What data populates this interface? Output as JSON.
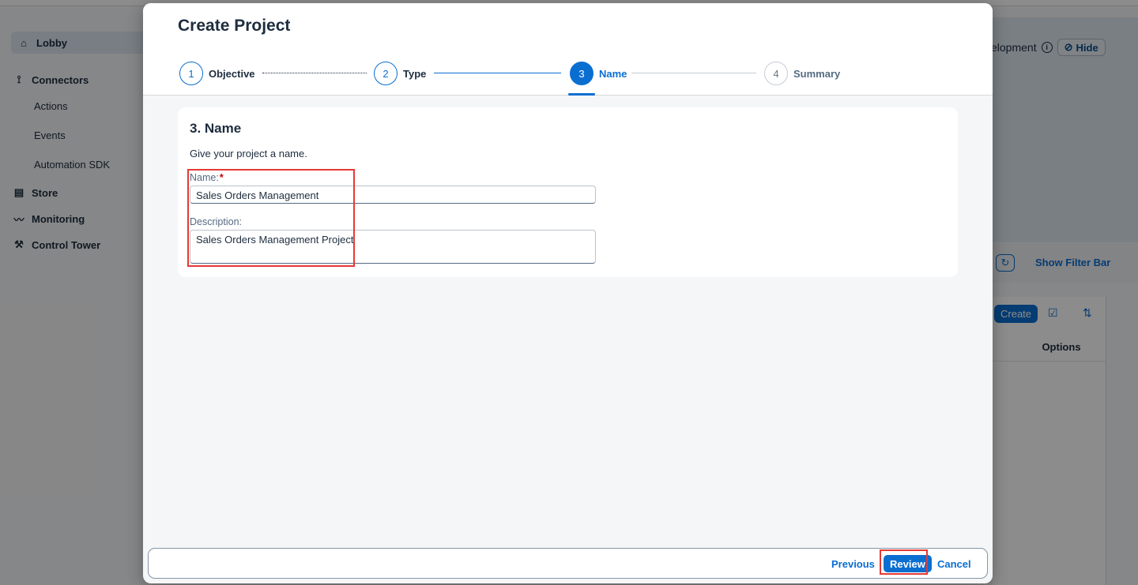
{
  "background": {
    "sidebar": {
      "items": [
        {
          "label": "Lobby",
          "icon": "home-icon"
        },
        {
          "label": "Connectors",
          "icon": "connector-icon"
        },
        {
          "label": "Actions"
        },
        {
          "label": "Events"
        },
        {
          "label": "Automation SDK"
        },
        {
          "label": "Store",
          "icon": "store-icon"
        },
        {
          "label": "Monitoring",
          "icon": "chart-line-icon"
        },
        {
          "label": "Control Tower",
          "icon": "wrench-icon"
        }
      ]
    },
    "banner": {
      "text": "elopment",
      "hide_label": "Hide"
    },
    "filter": {
      "show_filter_label": "Show Filter Bar"
    },
    "table": {
      "create_label": "Create",
      "options_header": "Options"
    }
  },
  "dialog": {
    "title": "Create Project",
    "steps": [
      {
        "number": "1",
        "label": "Objective"
      },
      {
        "number": "2",
        "label": "Type"
      },
      {
        "number": "3",
        "label": "Name"
      },
      {
        "number": "4",
        "label": "Summary"
      }
    ],
    "section": {
      "title": "3. Name",
      "description": "Give your project a name.",
      "name_label": "Name:",
      "required_mark": "*",
      "name_value": "Sales Orders Management",
      "description_label": "Description:",
      "description_value": "Sales Orders Management Project"
    },
    "footer": {
      "previous_label": "Previous",
      "review_label": "Review",
      "cancel_label": "Cancel"
    }
  },
  "colors": {
    "accent": "#0a6ed1",
    "highlight": "#e53935",
    "text": "#1d2d3e"
  }
}
